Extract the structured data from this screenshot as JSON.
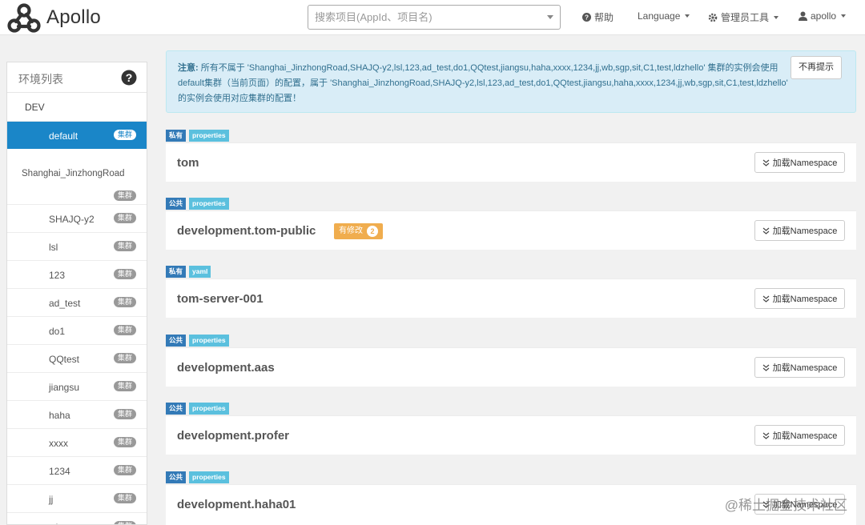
{
  "app": {
    "name": "Apollo"
  },
  "search": {
    "placeholder": "搜索项目(AppId、项目名)"
  },
  "nav": {
    "help": "帮助",
    "language": "Language",
    "admin_tools": "管理员工具",
    "user": "apollo"
  },
  "sidebar": {
    "title": "环境列表",
    "env": "DEV",
    "clusters": [
      {
        "name": "default",
        "badge": "集群",
        "active": true
      },
      {
        "name": "Shanghai_JinzhongRoad",
        "badge": "集群"
      },
      {
        "name": "SHAJQ-y2",
        "badge": "集群"
      },
      {
        "name": "lsl",
        "badge": "集群"
      },
      {
        "name": "123",
        "badge": "集群"
      },
      {
        "name": "ad_test",
        "badge": "集群"
      },
      {
        "name": "do1",
        "badge": "集群"
      },
      {
        "name": "QQtest",
        "badge": "集群"
      },
      {
        "name": "jiangsu",
        "badge": "集群"
      },
      {
        "name": "haha",
        "badge": "集群"
      },
      {
        "name": "xxxx",
        "badge": "集群"
      },
      {
        "name": "1234",
        "badge": "集群"
      },
      {
        "name": "jj",
        "badge": "集群"
      },
      {
        "name": "wb",
        "badge": "集群"
      }
    ]
  },
  "notice": {
    "label": "注意:",
    "text": " 所有不属于 'Shanghai_JinzhongRoad,SHAJQ-y2,lsl,123,ad_test,do1,QQtest,jiangsu,haha,xxxx,1234,jj,wb,sgp,sit,C1,test,ldzhello' 集群的实例会使用default集群（当前页面）的配置，属于 'Shanghai_JinzhongRoad,SHAJQ-y2,lsl,123,ad_test,do1,QQtest,jiangsu,haha,xxxx,1234,jj,wb,sgp,sit,C1,test,ldzhello' 的实例会使用对应集群的配置！",
    "dismiss": "不再提示"
  },
  "namespaces": [
    {
      "scope": "私有",
      "format": "properties",
      "name": "tom",
      "load_label": "加载Namespace"
    },
    {
      "scope": "公共",
      "format": "properties",
      "name": "development.tom-public",
      "modified_label": "有修改",
      "modified_count": "2",
      "load_label": "加载Namespace"
    },
    {
      "scope": "私有",
      "format": "yaml",
      "name": "tom-server-001",
      "load_label": "加载Namespace"
    },
    {
      "scope": "公共",
      "format": "properties",
      "name": "development.aas",
      "load_label": "加载Namespace"
    },
    {
      "scope": "公共",
      "format": "properties",
      "name": "development.profer",
      "load_label": "加载Namespace"
    },
    {
      "scope": "公共",
      "format": "properties",
      "name": "development.haha01",
      "load_label": "加载Namespace"
    }
  ],
  "watermark": "@稀土掘金技术社区",
  "colors": {
    "primary": "#1a86c8",
    "info_bg": "#d9edf7",
    "info_text": "#31708f",
    "warning": "#f0ad4e",
    "tag_private": "#337ab7",
    "tag_format": "#5bc0de"
  }
}
